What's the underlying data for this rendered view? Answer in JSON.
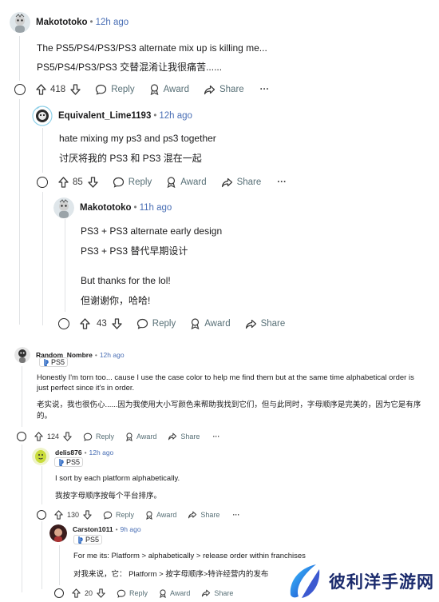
{
  "comments": [
    {
      "id": "c1",
      "user": "Makototoko",
      "time": "12h ago",
      "lines": [
        "The PS5/PS4/PS3/PS3 alternate mix up is killing me...",
        "PS5/PS4/PS3/PS3 交替混淆让我很痛苦......"
      ],
      "votes": "418"
    },
    {
      "id": "c2",
      "user": "Equivalent_Lime1193",
      "time": "12h ago",
      "lines": [
        "hate mixing my ps3 and ps3 together",
        "讨厌将我的 PS3 和 PS3 混在一起"
      ],
      "votes": "85"
    },
    {
      "id": "c3",
      "user": "Makototoko",
      "time": "11h ago",
      "lines": [
        "PS3 + PS3 alternate early design",
        "PS3 + PS3 替代早期设计",
        "But thanks for the lol!",
        "但谢谢你，哈哈!"
      ],
      "votes": "43"
    },
    {
      "id": "c4",
      "user": "Random_Nombre",
      "time": "12h ago",
      "flair": "PS5",
      "lines": [
        "Honestly I'm torn too... cause I use the case color to help me find them but at the same time alphabetical order is just perfect since it's in order.",
        "老实说，我也很伤心......因为我使用大小写颜色来帮助我找到它们，但与此同时，字母顺序是完美的，因为它是有序的。"
      ],
      "votes": "124"
    },
    {
      "id": "c5",
      "user": "delis876",
      "time": "12h ago",
      "flair": "PS5",
      "lines": [
        "I sort by each platform alphabetically.",
        "我按字母顺序按每个平台排序。"
      ],
      "votes": "130"
    },
    {
      "id": "c6",
      "user": "Carston1011",
      "time": "9h ago",
      "flair": "PS5",
      "lines": [
        "For me its: Platform > alphabetically > release order within franchises",
        "对我来说，它：  Platform > 按字母顺序>特许经营内的发布"
      ],
      "votes": "20"
    }
  ],
  "actions": {
    "reply": "Reply",
    "award": "Award",
    "share": "Share",
    "more": "···"
  },
  "watermark": {
    "text": "彼利洋手游网"
  }
}
